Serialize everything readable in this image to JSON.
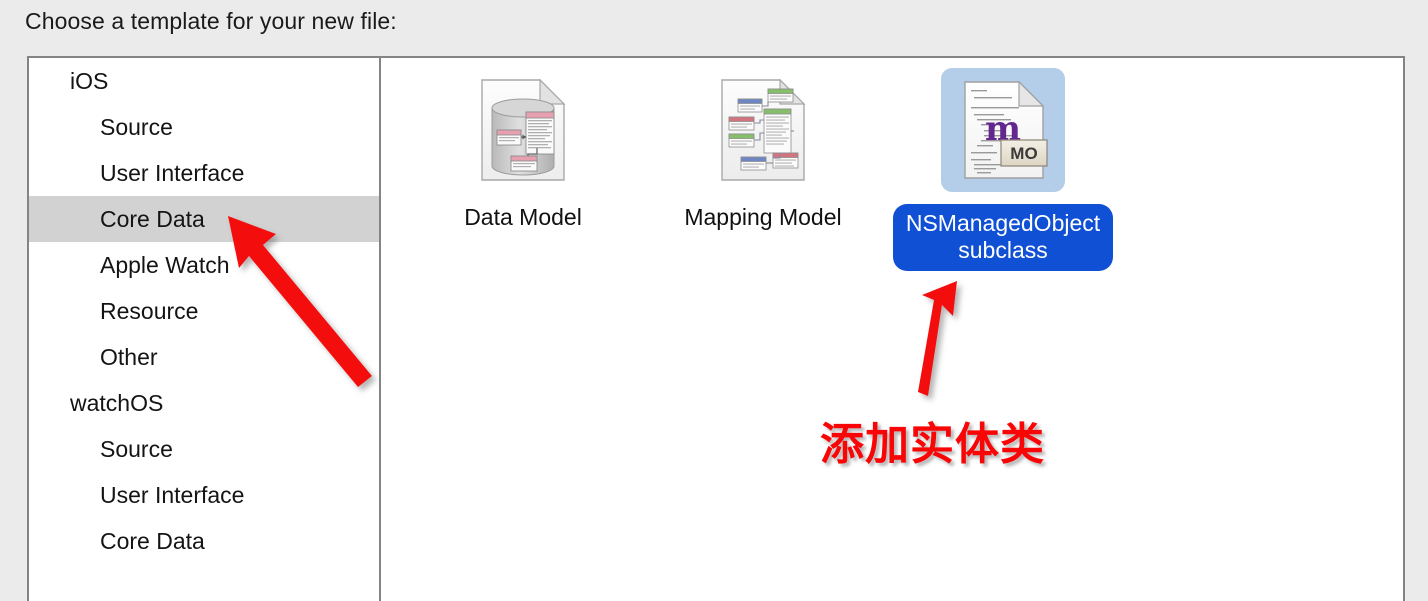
{
  "prompt": "Choose a template for your new file:",
  "sidebar": {
    "groups": [
      {
        "label": "iOS",
        "items": [
          {
            "label": "Source",
            "selected": false
          },
          {
            "label": "User Interface",
            "selected": false
          },
          {
            "label": "Core Data",
            "selected": true
          },
          {
            "label": "Apple Watch",
            "selected": false
          },
          {
            "label": "Resource",
            "selected": false
          },
          {
            "label": "Other",
            "selected": false
          }
        ]
      },
      {
        "label": "watchOS",
        "items": [
          {
            "label": "Source",
            "selected": false
          },
          {
            "label": "User Interface",
            "selected": false
          },
          {
            "label": "Core Data",
            "selected": false
          }
        ]
      }
    ]
  },
  "templates": [
    {
      "label": "Data Model",
      "icon": "data-model-file-icon",
      "selected": false
    },
    {
      "label": "Mapping Model",
      "icon": "mapping-model-file-icon",
      "selected": false
    },
    {
      "label": "NSManagedObject subclass",
      "icon": "nsmanagedobject-file-icon",
      "selected": true,
      "badge": "MO",
      "glyph": "m"
    }
  ],
  "annotations": {
    "text": "添加实体类",
    "arrow_to_core_data": "arrow-pointing-to-core-data",
    "arrow_to_template": "arrow-pointing-to-nsmanagedobject-template"
  },
  "colors": {
    "window_background": "#ebebeb",
    "panel_background": "#ffffff",
    "panel_border": "#848484",
    "sidebar_selection": "#d2d2d2",
    "icon_selection": "#b4cde9",
    "label_selection": "#1050d4",
    "annotation_red": "#fa0505",
    "badge_background": "#e8e2d5"
  }
}
